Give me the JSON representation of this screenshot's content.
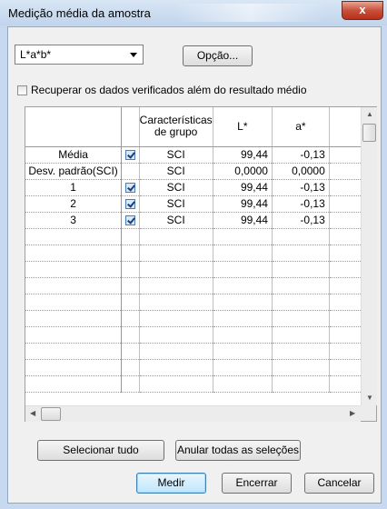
{
  "window": {
    "title": "Medição média da amostra",
    "close_label": "x"
  },
  "color_space": {
    "selected": "L*a*b*"
  },
  "option_button": "Opção...",
  "recover_checkbox": {
    "label": "Recuperar os dados verificados além do resultado médio",
    "checked": false
  },
  "table": {
    "headers": [
      "Características de grupo",
      "L*",
      "a*"
    ],
    "rows": [
      {
        "label": "Média",
        "checked": true,
        "group": "SCI",
        "L": "99,44",
        "a": "-0,13",
        "extra": ""
      },
      {
        "label": "Desv. padrão(SCI)",
        "checked": false,
        "group": "SCI",
        "L": "0,0000",
        "a": "0,0000",
        "extra": "("
      },
      {
        "label": "1",
        "checked": true,
        "group": "SCI",
        "L": "99,44",
        "a": "-0,13",
        "extra": ""
      },
      {
        "label": "2",
        "checked": true,
        "group": "SCI",
        "L": "99,44",
        "a": "-0,13",
        "extra": ""
      },
      {
        "label": "3",
        "checked": true,
        "group": "SCI",
        "L": "99,44",
        "a": "-0,13",
        "extra": ""
      }
    ]
  },
  "buttons": {
    "select_all": "Selecionar tudo",
    "clear_all": "Anular todas as seleções",
    "measure": "Medir",
    "close": "Encerrar",
    "cancel": "Cancelar"
  }
}
